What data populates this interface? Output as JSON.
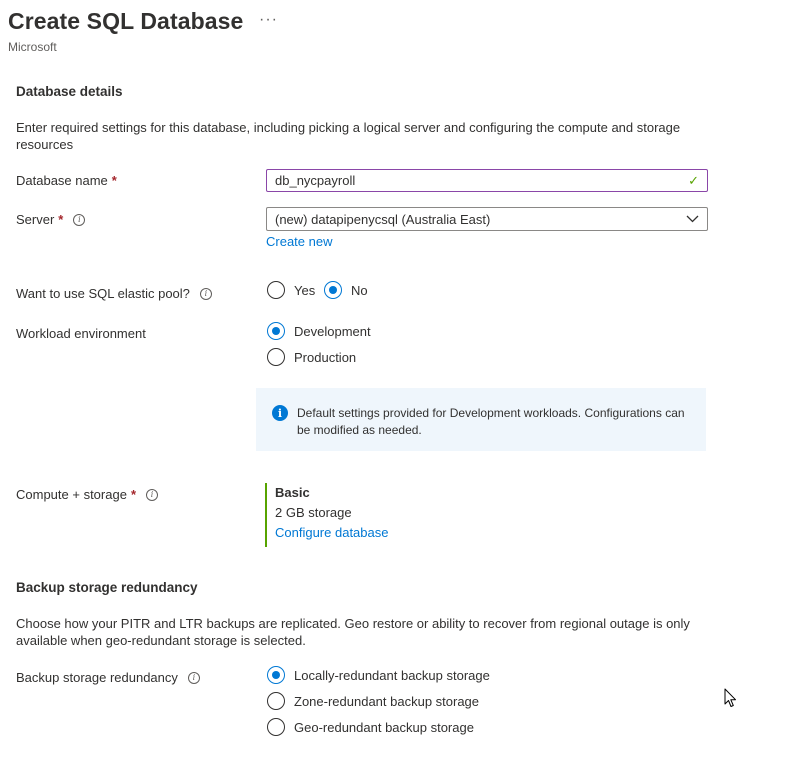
{
  "header": {
    "title": "Create SQL Database",
    "more_label": "···",
    "publisher": "Microsoft"
  },
  "database_details": {
    "heading": "Database details",
    "description": "Enter required settings for this database, including picking a logical server and configuring the compute and storage resources",
    "database_name": {
      "label": "Database name",
      "required_mark": "*",
      "value": "db_nycpayroll",
      "valid_mark": "✓"
    },
    "server": {
      "label": "Server",
      "required_mark": "*",
      "value": "(new) datapipenycsql (Australia East)",
      "create_new_label": "Create new"
    },
    "elastic_pool": {
      "label": "Want to use SQL elastic pool?",
      "options": [
        "Yes",
        "No"
      ],
      "selected": "No"
    },
    "workload": {
      "label": "Workload environment",
      "options": [
        "Development",
        "Production"
      ],
      "selected": "Development",
      "info_banner": "Default settings provided for Development workloads. Configurations can be modified as needed."
    },
    "compute_storage": {
      "label": "Compute + storage",
      "required_mark": "*",
      "tier": "Basic",
      "storage": "2 GB storage",
      "configure_label": "Configure database"
    }
  },
  "backup": {
    "heading": "Backup storage redundancy",
    "description": "Choose how your PITR and LTR backups are replicated. Geo restore or ability to recover from regional outage is only available when geo-redundant storage is selected.",
    "label": "Backup storage redundancy",
    "options": [
      "Locally-redundant backup storage",
      "Zone-redundant backup storage",
      "Geo-redundant backup storage"
    ],
    "selected": "Locally-redundant backup storage"
  },
  "colors": {
    "accent": "#0078d4",
    "required": "#a4262c",
    "valid": "#57a300",
    "focus_border": "#8a46a8",
    "banner_bg": "#eff6fc"
  },
  "icons": {
    "info": "info-icon",
    "checkmark": "checkmark-icon",
    "dropdown": "chevron-down-icon",
    "banner": "info-filled-icon",
    "cursor": "mouse-pointer-icon"
  }
}
